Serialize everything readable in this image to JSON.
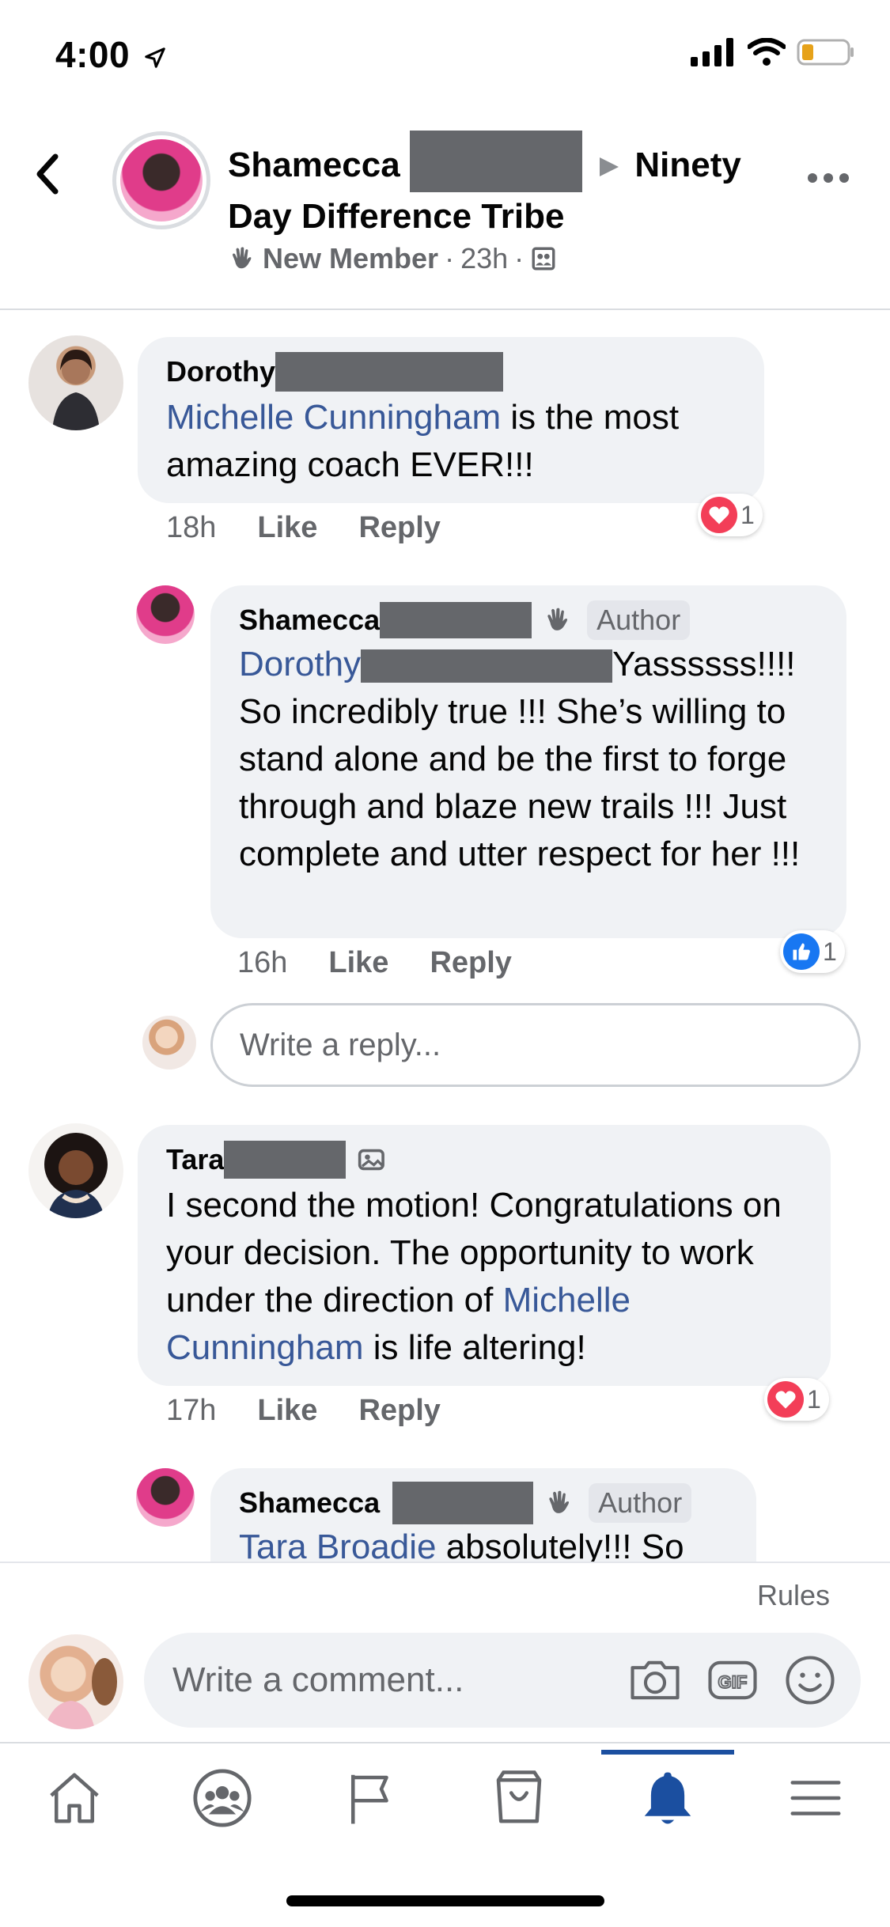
{
  "status": {
    "time": "4:00"
  },
  "header": {
    "name_start": "Shamecca",
    "group_name_part1": "Ninety",
    "group_name_part2": "Day Difference Tribe",
    "member_badge": "New Member",
    "time": "23h",
    "separator": "·"
  },
  "comments": [
    {
      "name": "Dorothy",
      "mention": "Michelle Cunningham",
      "text": " is the most amazing coach EVER!!!",
      "time": "18h",
      "like": "Like",
      "reply": "Reply",
      "reaction_count": "1"
    },
    {
      "name": "Shamecca",
      "author_badge": "Author",
      "mention": "Dorothy",
      "text_after_mention": "Yassssss!!!!",
      "text": "So incredibly true !!! She’s willing to stand alone and be the first to forge through and blaze new trails !!! Just complete and utter respect for her !!!",
      "time": "16h",
      "like": "Like",
      "reply": "Reply",
      "reaction_count": "1"
    },
    {
      "name": "Tara",
      "text_before": "I second the motion! Congratulations on your decision. The opportunity to work under the direction of ",
      "mention": "Michelle Cunningham",
      "text_after": " is life altering!",
      "time": "17h",
      "like": "Like",
      "reply": "Reply",
      "reaction_count": "1"
    },
    {
      "name": "Shamecca",
      "author_badge": "Author",
      "mention": "Tara Broadie",
      "text": " absolutely!!! So"
    }
  ],
  "reply_input": {
    "placeholder": "Write a reply..."
  },
  "rules_label": "Rules",
  "comment_input": {
    "placeholder": "Write a comment..."
  },
  "tabs": [
    "home",
    "groups",
    "pages",
    "marketplace",
    "notifications",
    "menu"
  ],
  "colors": {
    "mention": "#385898",
    "accent": "#1b4fa0",
    "love": "#f33e58",
    "like": "#1877f2"
  }
}
